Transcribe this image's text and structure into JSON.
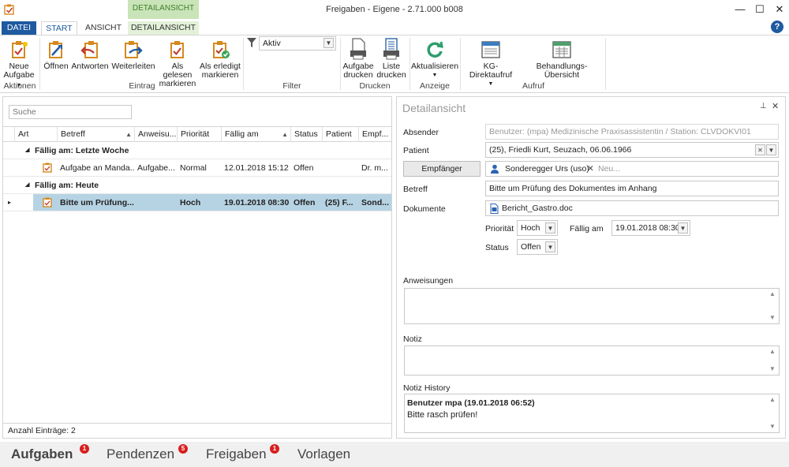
{
  "window": {
    "title": "Freigaben - Eigene - 2.71.000 b008"
  },
  "tabs": {
    "datei": "DATEI",
    "start": "START",
    "ansicht": "ANSICHT",
    "context_band": "DETAILANSICHT",
    "detailansicht": "DETAILANSICHT"
  },
  "ribbon": {
    "neue_aufgabe_1": "Neue",
    "neue_aufgabe_2": "Aufgabe",
    "oeffnen": "Öffnen",
    "antworten": "Antworten",
    "weiterleiten": "Weiterleiten",
    "gelesen_1": "Als gelesen",
    "gelesen_2": "markieren",
    "erledigt_1": "Als erledigt",
    "erledigt_2": "markieren",
    "filter_value": "Aktiv",
    "aufgabe_drucken_1": "Aufgabe",
    "aufgabe_drucken_2": "drucken",
    "liste_drucken_1": "Liste",
    "liste_drucken_2": "drucken",
    "aktualisieren": "Aktualisieren",
    "kg_direkt": "KG-Direktaufruf",
    "behandlungs": "Behandlungs-Übersicht",
    "groups": {
      "aktionen": "Aktionen",
      "eintrag": "Eintrag",
      "filter": "Filter",
      "drucken": "Drucken",
      "anzeige": "Anzeige",
      "aufruf": "Aufruf"
    }
  },
  "list": {
    "search_placeholder": "Suche",
    "columns": {
      "art": "Art",
      "betreff": "Betreff",
      "anweisung": "Anweisu...",
      "prioritaet": "Priorität",
      "faellig": "Fällig am",
      "status": "Status",
      "patient": "Patient",
      "empf": "Empf..."
    },
    "group1": "Fällig am: Letzte Woche",
    "row1": {
      "betreff": "Aufgabe an Manda...",
      "anweisung": "Aufgabe...",
      "prioritaet": "Normal",
      "faellig": "12.01.2018 15:12",
      "status": "Offen",
      "patient": "",
      "empf": "Dr. m..."
    },
    "group2": "Fällig am: Heute",
    "row2": {
      "betreff": "Bitte um Prüfung...",
      "anweisung": "",
      "prioritaet": "Hoch",
      "faellig": "19.01.2018 08:30",
      "status": "Offen",
      "patient": "(25) F...",
      "empf": "Sond..."
    },
    "count": "Anzahl Einträge: 2"
  },
  "detail": {
    "title": "Detailansicht",
    "labels": {
      "absender": "Absender",
      "patient": "Patient",
      "empfaenger_btn": "Empfänger",
      "betreff": "Betreff",
      "dokumente": "Dokumente",
      "prioritaet": "Priorität",
      "faellig": "Fällig am",
      "status": "Status",
      "anweisungen": "Anweisungen",
      "notiz": "Notiz",
      "history": "Notiz History"
    },
    "absender_value": "Benutzer: (mpa) Medizinische Praxisassistentin / Station: CLVDOKVI01",
    "patient_value": "(25), Friedli Kurt, Seuzach, 06.06.1966",
    "recipient": "Sonderegger Urs (uso)",
    "recipient_placeholder": "Neu...",
    "betreff_value": "Bitte um Prüfung des Dokumentes im Anhang",
    "dokument": "Bericht_Gastro.doc",
    "prioritaet_value": "Hoch",
    "faellig_value": "19.01.2018 08:30",
    "status_value": "Offen",
    "history_header": "Benutzer mpa (19.01.2018 06:52)",
    "history_text": "Bitte rasch prüfen!"
  },
  "nav": {
    "aufgaben": "Aufgaben",
    "aufgaben_badge": "1",
    "pendenzen": "Pendenzen",
    "pendenzen_badge": "5",
    "freigaben": "Freigaben",
    "freigaben_badge": "1",
    "vorlagen": "Vorlagen"
  },
  "colors": {
    "accent": "#1e5aa0",
    "selected_row": "#b6d3e3",
    "context_tab": "#c9e4b8",
    "badge": "#d81e1e"
  }
}
